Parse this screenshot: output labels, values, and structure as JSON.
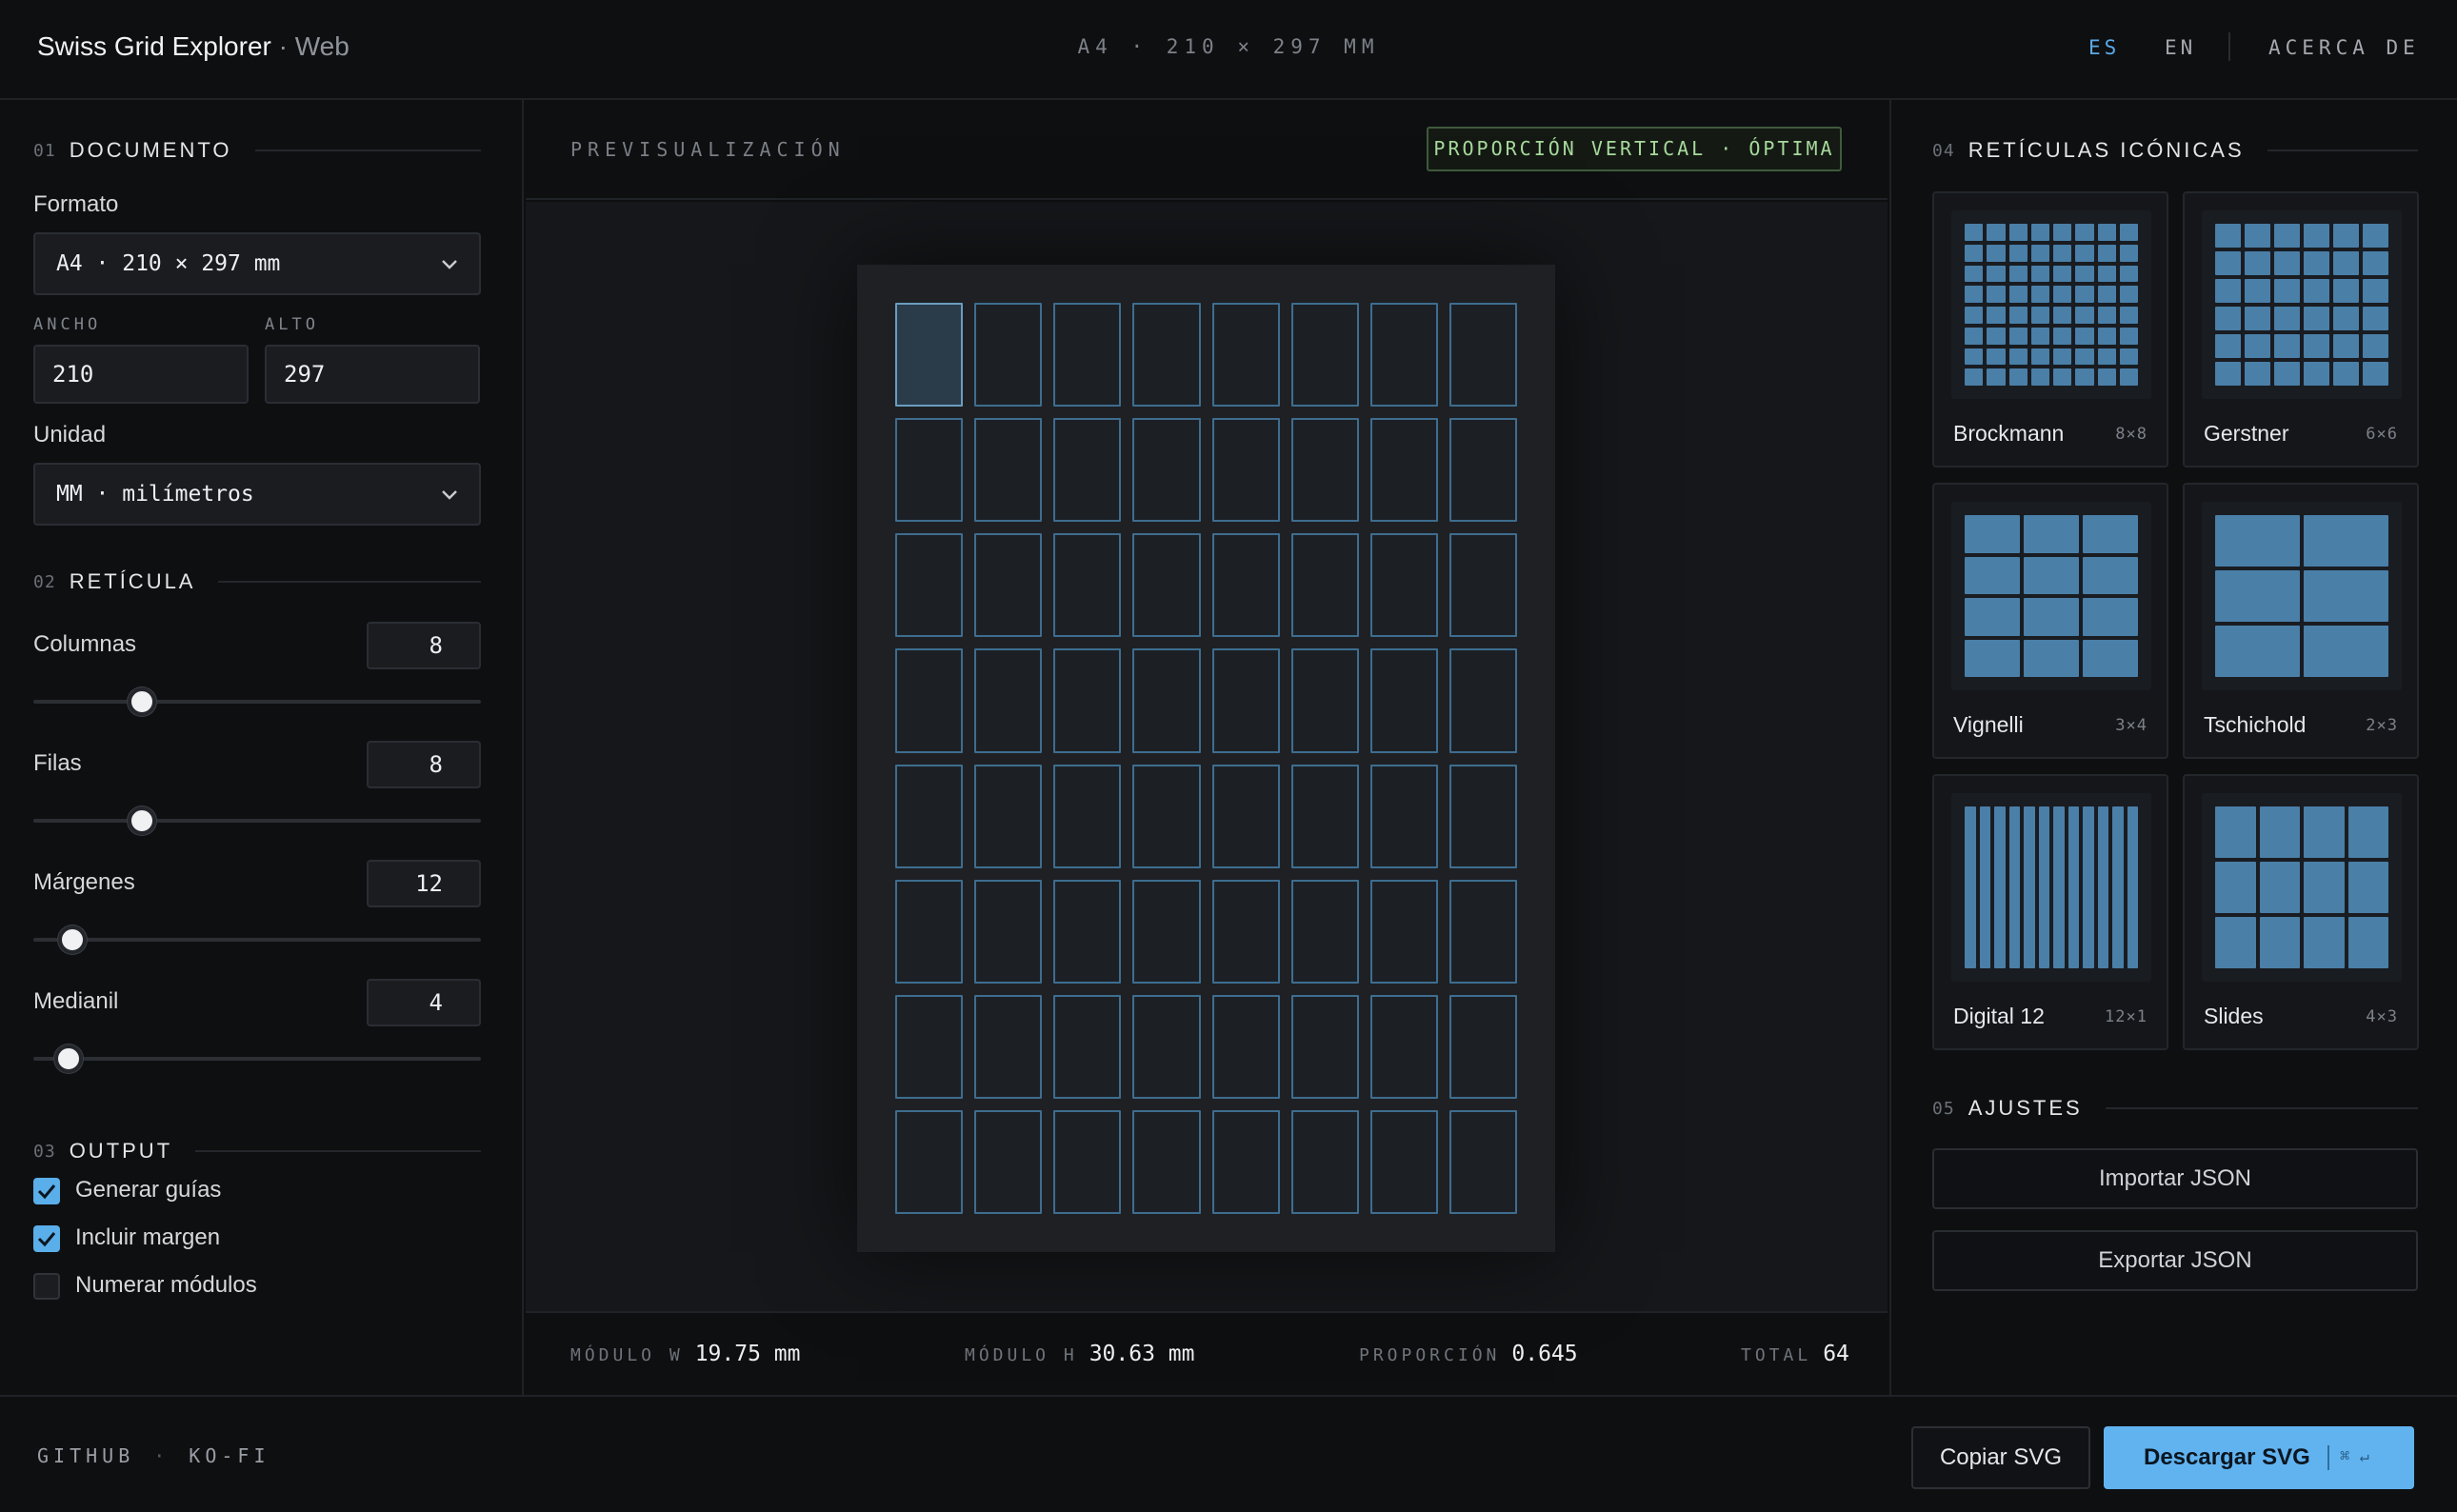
{
  "header": {
    "brand": "Swiss Grid Explorer",
    "brand_sub": "· Web",
    "doc_size": "A4 · 210 × 297 MM",
    "lang_es": "ES",
    "lang_en": "EN",
    "about": "ACERCA DE"
  },
  "left": {
    "documento": {
      "num": "01",
      "title": "DOCUMENTO",
      "formato_label": "Formato",
      "formato_value": "A4 · 210 × 297 mm",
      "ancho_label": "ANCHO",
      "ancho_value": "210",
      "alto_label": "ALTO",
      "alto_value": "297",
      "unidad_label": "Unidad",
      "unidad_value": "MM · milímetros"
    },
    "reticula": {
      "num": "02",
      "title": "RETÍCULA",
      "columnas_label": "Columnas",
      "columnas_value": "8",
      "filas_label": "Filas",
      "filas_value": "8",
      "margenes_label": "Márgenes",
      "margenes_value": "12",
      "medianil_label": "Medianil",
      "medianil_value": "4"
    },
    "output": {
      "num": "03",
      "title": "OUTPUT",
      "generar_guias": "Generar guías",
      "incluir_margen": "Incluir margen",
      "numerar_modulos": "Numerar módulos"
    }
  },
  "center": {
    "preview_title": "PREVISUALIZACIÓN",
    "badge": "PROPORCIÓN VERTICAL · ÓPTIMA",
    "grid": {
      "columns": 8,
      "rows": 8
    },
    "stats": {
      "modulo_w_label": "MÓDULO W",
      "modulo_w_value": "19.75 mm",
      "modulo_h_label": "MÓDULO H",
      "modulo_h_value": "30.63 mm",
      "proporcion_label": "PROPORCIÓN",
      "proporcion_value": "0.645",
      "total_label": "TOTAL",
      "total_value": "64"
    }
  },
  "right": {
    "iconic": {
      "num": "04",
      "title": "RETÍCULAS ICÓNICAS",
      "cards": [
        {
          "name": "Brockmann",
          "dims": "8×8"
        },
        {
          "name": "Gerstner",
          "dims": "6×6"
        },
        {
          "name": "Vignelli",
          "dims": "3×4"
        },
        {
          "name": "Tschichold",
          "dims": "2×3"
        },
        {
          "name": "Digital 12",
          "dims": "12×1"
        },
        {
          "name": "Slides",
          "dims": "4×3"
        }
      ]
    },
    "ajustes": {
      "num": "05",
      "title": "AJUSTES",
      "importar": "Importar JSON",
      "exportar": "Exportar JSON"
    }
  },
  "footer": {
    "github": "GITHUB",
    "sep": "·",
    "kofi": "KO-FI",
    "copy": "Copiar SVG",
    "download": "Descargar SVG",
    "shortcut": "⌘ ↵"
  },
  "colors": {
    "accent": "#61b3f0",
    "module_border": "#3e6d8f",
    "thumb_cell": "#4a7fa8",
    "badge_text": "#a7d99c"
  }
}
